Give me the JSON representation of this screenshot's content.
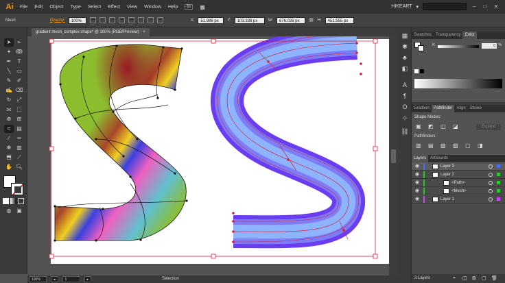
{
  "app": {
    "logo": "Ai",
    "workspace": "HIKEART"
  },
  "menu": [
    "File",
    "Edit",
    "Object",
    "Type",
    "Select",
    "Effect",
    "View",
    "Window",
    "Help"
  ],
  "menu_extra": {
    "bridge": "Br"
  },
  "control_bar": {
    "tool_name": "Mesh",
    "opacity_label": "Opacity:",
    "opacity_value": "100%",
    "x_label": "X:",
    "x_value": "51.986 px",
    "y_label": "Y:",
    "y_value": "103.338 px",
    "w_label": "W:",
    "w_value": "676.026 px",
    "h_label": "H:",
    "h_value": "451.555 px"
  },
  "document": {
    "tab_title": "gradient mesh_complex shape* @ 100% (RGB/Preview)",
    "close": "×"
  },
  "status": {
    "zoom": "100%",
    "page": "1",
    "tool": "Selection"
  },
  "color_panel": {
    "tabs": [
      "Swatches",
      "Transparency",
      "Color"
    ],
    "channel_label": "K",
    "channel_value": "0",
    "channel_unit": "%"
  },
  "pathfinder_panel": {
    "tabs": [
      "Gradient",
      "Pathfinder",
      "Align",
      "Stroke"
    ],
    "shape_modes_label": "Shape Modes:",
    "expand_label": "Expand",
    "pathfinders_label": "Pathfinders:"
  },
  "layers_panel": {
    "tabs": [
      "Layers",
      "Artboards"
    ],
    "rows": [
      {
        "name": "Layer 3",
        "color": "#4a6cff"
      },
      {
        "name": "Layer 2",
        "color": "#22cc22"
      },
      {
        "name": "<Path>",
        "color": "#22cc22"
      },
      {
        "name": "<Mesh>",
        "color": "#22cc22"
      },
      {
        "name": "Layer 1",
        "color": "#cc44ff"
      }
    ],
    "footer": "3 Layers"
  },
  "colors": {
    "accent": "#ff9a00",
    "selection_red": "#d31f3f",
    "mesh_green": "#8cbd2e",
    "s_blue_edge": "#6a3cf2",
    "s_blue_center": "#8fb4ff"
  }
}
